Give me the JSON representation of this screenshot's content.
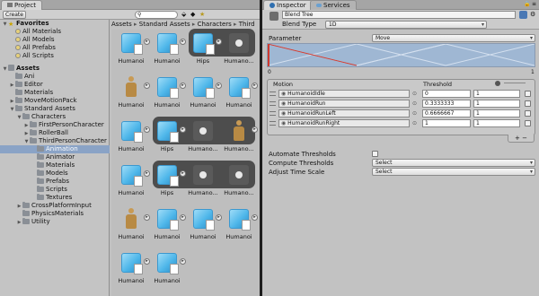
{
  "project_panel": {
    "tab_label": "Project",
    "create_label": "Create",
    "breadcrumb": [
      "Assets",
      "Standard Assets",
      "Characters",
      "Third"
    ],
    "breadcrumb_sep": "▸",
    "tree": [
      {
        "label": "Favorites",
        "depth": 0,
        "expanded": true,
        "kind": "header"
      },
      {
        "label": "All Materials",
        "depth": 1,
        "kind": "search"
      },
      {
        "label": "All Models",
        "depth": 1,
        "kind": "search"
      },
      {
        "label": "All Prefabs",
        "depth": 1,
        "kind": "search"
      },
      {
        "label": "All Scripts",
        "depth": 1,
        "kind": "search"
      },
      {
        "label": "",
        "depth": 0,
        "kind": "spacer"
      },
      {
        "label": "Assets",
        "depth": 0,
        "expanded": true,
        "kind": "header"
      },
      {
        "label": "Ani",
        "depth": 1,
        "kind": "folder"
      },
      {
        "label": "Editor",
        "depth": 1,
        "expanded": false,
        "kind": "folder"
      },
      {
        "label": "Materials",
        "depth": 1,
        "kind": "folder"
      },
      {
        "label": "MoveMotionPack",
        "depth": 1,
        "expanded": false,
        "kind": "folder"
      },
      {
        "label": "Standard Assets",
        "depth": 1,
        "expanded": true,
        "kind": "folder"
      },
      {
        "label": "Characters",
        "depth": 2,
        "expanded": true,
        "kind": "folder"
      },
      {
        "label": "FirstPersonCharacter",
        "depth": 3,
        "expanded": false,
        "kind": "folder"
      },
      {
        "label": "RollerBall",
        "depth": 3,
        "expanded": false,
        "kind": "folder"
      },
      {
        "label": "ThirdPersonCharacter",
        "depth": 3,
        "expanded": true,
        "kind": "folder"
      },
      {
        "label": "Animation",
        "depth": 4,
        "kind": "folder",
        "selected": true
      },
      {
        "label": "Animator",
        "depth": 4,
        "kind": "folder"
      },
      {
        "label": "Materials",
        "depth": 4,
        "kind": "folder"
      },
      {
        "label": "Models",
        "depth": 4,
        "kind": "folder"
      },
      {
        "label": "Prefabs",
        "depth": 4,
        "kind": "folder"
      },
      {
        "label": "Scripts",
        "depth": 4,
        "kind": "folder"
      },
      {
        "label": "Textures",
        "depth": 4,
        "kind": "folder"
      },
      {
        "label": "CrossPlatformInput",
        "depth": 2,
        "expanded": false,
        "kind": "folder"
      },
      {
        "label": "PhysicsMaterials",
        "depth": 2,
        "kind": "folder"
      },
      {
        "label": "Utility",
        "depth": 2,
        "expanded": false,
        "kind": "folder"
      }
    ],
    "asset_rows": [
      [
        {
          "t": "cube",
          "l": "Humanoi"
        },
        {
          "t": "cube",
          "l": "Humanoi"
        },
        {
          "t": "cube",
          "l": "Hips"
        },
        {
          "t": "play",
          "l": "Humano..."
        }
      ],
      [
        {
          "t": "man",
          "l": "Humanoi"
        },
        {
          "t": "cube",
          "l": "Humanoi"
        },
        {
          "t": "cube",
          "l": "Humanoi"
        },
        {
          "t": "cube",
          "l": "Humanoi"
        }
      ],
      [
        {
          "t": "cube",
          "l": "Humanoi"
        },
        {
          "t": "cube",
          "l": "Hips"
        },
        {
          "t": "play",
          "l": "Humano..."
        },
        {
          "t": "man",
          "l": "Humano..."
        }
      ],
      [
        {
          "t": "cube",
          "l": "Humanoi"
        },
        {
          "t": "cube",
          "l": "Hips"
        },
        {
          "t": "play",
          "l": "Humano..."
        },
        {
          "t": "play",
          "l": "Humano..."
        }
      ],
      [
        {
          "t": "man",
          "l": "Humanoi"
        },
        {
          "t": "cube",
          "l": "Humanoi"
        },
        {
          "t": "cube",
          "l": "Humanoi"
        },
        {
          "t": "cube",
          "l": "Humanoi"
        }
      ],
      [
        {
          "t": "cube",
          "l": "Humanoi"
        },
        {
          "t": "cube",
          "l": "Humanoi"
        }
      ]
    ]
  },
  "inspector": {
    "tab_label": "Inspector",
    "services_tab_label": "Services",
    "title": "Blend Tree",
    "blend_type_label": "Blend Type",
    "blend_type_value": "1D",
    "parameter_label": "Parameter",
    "parameter_value": "Move",
    "axis_min": "0",
    "axis_max": "1",
    "table_headers": {
      "motion": "Motion",
      "threshold": "Threshold"
    },
    "motions": [
      {
        "name": "HumanoidIdle",
        "threshold": "0",
        "speed": "1"
      },
      {
        "name": "HumanoidRun",
        "threshold": "0.3333333",
        "speed": "1"
      },
      {
        "name": "HumanoidRunLeft",
        "threshold": "0.6666667",
        "speed": "1"
      },
      {
        "name": "HumanoidRunRight",
        "threshold": "1",
        "speed": "1"
      }
    ],
    "add_label": "+-",
    "minus_label": "−",
    "automate_label": "Automate Thresholds",
    "compute_label": "Compute Thresholds",
    "compute_value": "Select",
    "adjust_label": "Adjust Time Scale",
    "adjust_value": "Select"
  },
  "colors": {
    "selection": "#8aa3c6",
    "cube": "#4fb7ea",
    "blend_line_red": "#d03a2f",
    "blend_line_blue": "#7aa6d6"
  }
}
